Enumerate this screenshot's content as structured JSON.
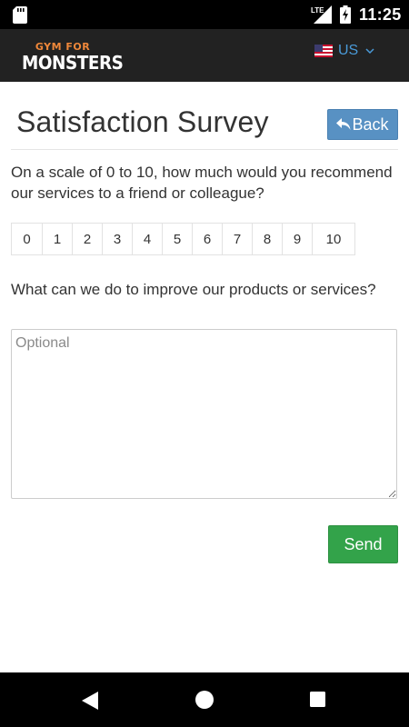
{
  "status_bar": {
    "time": "11:25",
    "network": "LTE",
    "icons": [
      "sd-card-icon",
      "lte-signal-icon",
      "battery-charging-icon"
    ]
  },
  "header": {
    "logo_top": "GYM FOR",
    "logo_main": "MONSTERS",
    "language_label": "US",
    "accent_color": "#4a9ad8"
  },
  "page": {
    "title": "Satisfaction Survey",
    "back_label": "Back",
    "back_color": "#5891c3"
  },
  "survey": {
    "question1": "On a scale of 0 to 10, how much would you recommend our services to a friend or colleague?",
    "scale": [
      "0",
      "1",
      "2",
      "3",
      "4",
      "5",
      "6",
      "7",
      "8",
      "9",
      "10"
    ],
    "question2": "What can we do to improve our products or services?",
    "comment_placeholder": "Optional",
    "send_label": "Send",
    "send_color": "#33a34a"
  },
  "nav_bar": {
    "icons": [
      "nav-back-icon",
      "nav-home-icon",
      "nav-recents-icon"
    ]
  }
}
